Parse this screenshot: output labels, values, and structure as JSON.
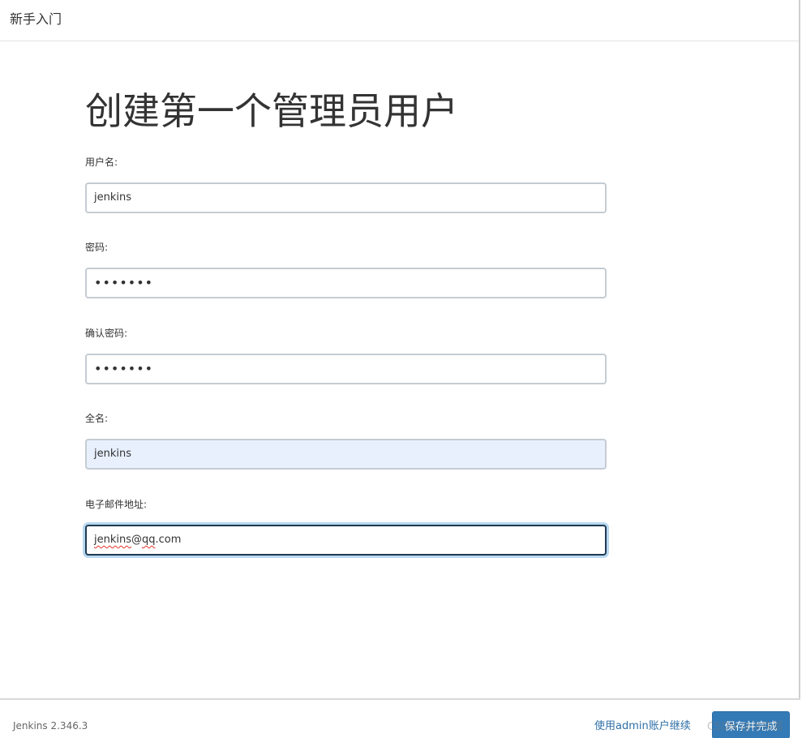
{
  "header": {
    "title": "新手入门"
  },
  "main": {
    "page_title": "创建第一个管理员用户",
    "fields": {
      "username": {
        "label": "用户名:",
        "value": "jenkins"
      },
      "password": {
        "label": "密码:",
        "value": "•••••••"
      },
      "confirm_password": {
        "label": "确认密码:",
        "value": "•••••••"
      },
      "full_name": {
        "label": "全名:",
        "value": "jenkins"
      },
      "email": {
        "label": "电子邮件地址:",
        "value_user": "jenkins",
        "value_at": "@",
        "value_domain": "qq",
        "value_tld": ".com"
      }
    }
  },
  "footer": {
    "version": "Jenkins 2.346.3",
    "continue_as_admin": "使用admin账户继续",
    "save_and_finish": "保存并完成",
    "watermark": "CSDN @涂抹漏"
  },
  "colors": {
    "primary_button": "#337ab7",
    "link": "#2f6fa7",
    "autofill_bg": "#e8f0fe",
    "focus_border": "#1f3a52"
  }
}
